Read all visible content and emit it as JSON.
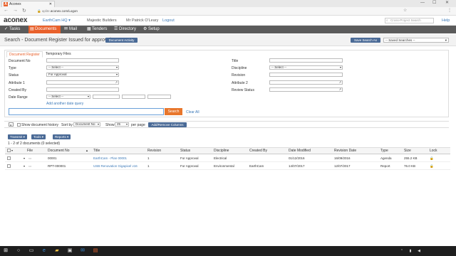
{
  "browser": {
    "tab_title": "Aconex",
    "url": "aconex.com/Logon",
    "url_prefix": "aplite.",
    "minimize": "—",
    "maximize": "☐",
    "close": "✕"
  },
  "header": {
    "logo": "aconex",
    "org": "EarthCam HQ",
    "company": "Majestic Builders",
    "user": "Mr Patrick O'Leary",
    "logout": "Logout",
    "search_placeholder": "Cross-Project Search",
    "help": "Help"
  },
  "nav": [
    {
      "label": "Tasks",
      "icon": "check-icon"
    },
    {
      "label": "Documents",
      "icon": "document-icon"
    },
    {
      "label": "Mail",
      "icon": "mail-icon"
    },
    {
      "label": "Tenders",
      "icon": "tender-icon"
    },
    {
      "label": "Directory",
      "icon": "directory-icon"
    },
    {
      "label": "Setup",
      "icon": "gear-icon"
    }
  ],
  "page": {
    "title": "Search - Document Register Issued for approval",
    "doc_activity_btn": "Document Activity",
    "save_search_btn": "Save Search As",
    "saved_searches": "-- Saved Searches --"
  },
  "form": {
    "tabs": [
      "Document Register",
      "Temporary Files"
    ],
    "left_fields": [
      {
        "label": "Document No",
        "value": ""
      },
      {
        "label": "Type",
        "value": "-- Select --"
      },
      {
        "label": "Status",
        "value": "For Approval"
      },
      {
        "label": "Attribute 1",
        "value": ""
      },
      {
        "label": "Created By",
        "value": ""
      },
      {
        "label": "Date Range",
        "value": "-- Select --"
      }
    ],
    "right_fields": [
      {
        "label": "Title",
        "value": ""
      },
      {
        "label": "Discipline",
        "value": "-- Select --"
      },
      {
        "label": "Revision",
        "value": ""
      },
      {
        "label": "Attribute 2",
        "value": ""
      },
      {
        "label": "Review Status",
        "value": ""
      }
    ],
    "add_date_query": "Add another date query",
    "search_btn": "Search",
    "clear_all": "Clear All"
  },
  "options": {
    "show_history": "Show document history",
    "sort_by_label": "Sort by",
    "sort_by_value": "Document No",
    "show_label": "Show",
    "show_value": "25",
    "per_page": "per page",
    "add_remove_cols": "Add/Remove Columns"
  },
  "toolbar": {
    "transmit": "Transmit",
    "tools": "Tools",
    "reports": "Reports",
    "count_text": "1 - 2 of 2 documents (0 selected)"
  },
  "table": {
    "headers": [
      "File",
      "Document No",
      "Title",
      "Revision",
      "Status",
      "Discipline",
      "Created By",
      "Date Modified",
      "Revision Date",
      "Type",
      "Size",
      "Lock"
    ],
    "rows": [
      [
        "00001",
        "EarthCam - Plan 00001",
        "1",
        "For Approval",
        "Electrical",
        "",
        "01/12/2016",
        "16/09/2016",
        "Agenda",
        "255.2 KB"
      ],
      [
        "RPT-000001",
        "USB Renovation Gigapixel v16",
        "1",
        "For Approval",
        "Environmental",
        "EarthCam",
        "14/07/2017",
        "12/07/2017",
        "Report",
        "76.0 KB"
      ]
    ]
  },
  "taskbar": {
    "time": "",
    "date": ""
  },
  "colors": {
    "accent": "#e8612c",
    "nav_bg": "#5b5b5b",
    "button_blue": "#4a6a96",
    "link": "#3d7ab8"
  }
}
